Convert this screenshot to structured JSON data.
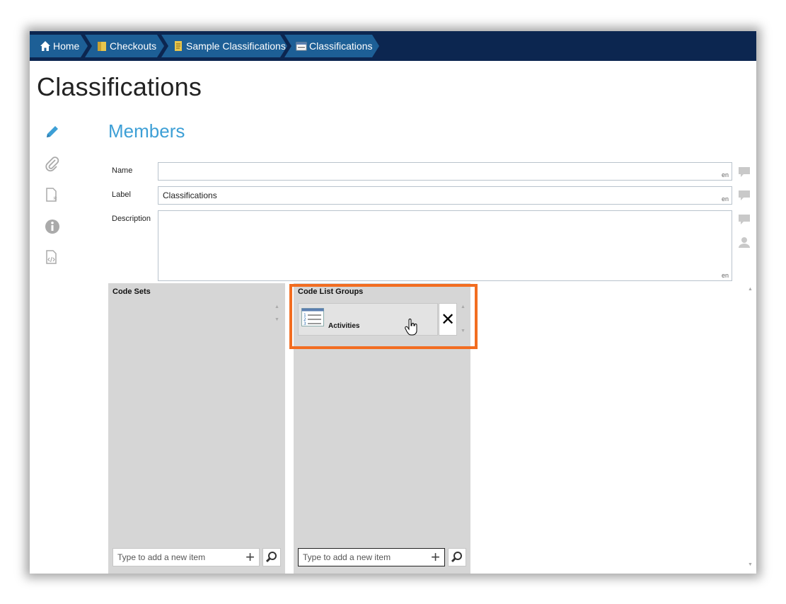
{
  "breadcrumb": [
    {
      "label": "Home",
      "icon": "home-icon"
    },
    {
      "label": "Checkouts",
      "icon": "checkouts-icon"
    },
    {
      "label": "Sample Classifications",
      "icon": "document-icon"
    },
    {
      "label": "Classifications",
      "icon": "classification-icon"
    }
  ],
  "page": {
    "title": "Classifications",
    "section_title": "Members"
  },
  "sidebar": {
    "icons": [
      "pencil-icon",
      "paperclip-icon",
      "document-star-icon",
      "info-icon",
      "code-document-icon"
    ]
  },
  "form": {
    "name": {
      "label": "Name",
      "value": "",
      "lang": "en"
    },
    "label": {
      "label": "Label",
      "value": "Classifications",
      "lang": "en"
    },
    "description": {
      "label": "Description",
      "value": "",
      "lang": "en"
    }
  },
  "panels": {
    "code_sets": {
      "title": "Code Sets",
      "add_placeholder": "Type to add a new item"
    },
    "code_list_groups": {
      "title": "Code List Groups",
      "items": [
        {
          "label": "Activities",
          "icon": "numbered-list-icon"
        }
      ],
      "remove_label": "✕",
      "add_placeholder": "Type to add a new item"
    }
  },
  "colors": {
    "nav_bg": "#0c2650",
    "crumb_bg": "#1d5f96",
    "accent": "#3d9fd6",
    "highlight": "#f26d21"
  }
}
